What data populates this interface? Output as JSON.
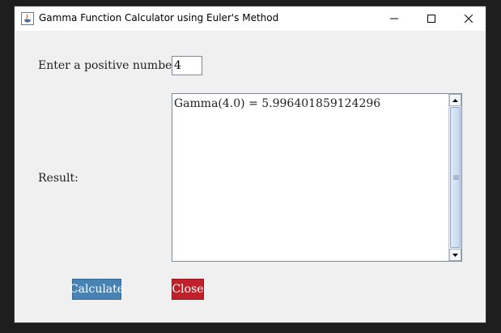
{
  "window": {
    "title": "Gamma Function Calculator using Euler's Method",
    "controls": {
      "minimize": "minimize-icon",
      "maximize": "maximize-icon",
      "close": "close-icon"
    }
  },
  "form": {
    "input_label": "Enter a positive number:",
    "input_value": "4",
    "result_label": "Result:",
    "result_text": "Gamma(4.0) = 5.996401859124296"
  },
  "buttons": {
    "calculate_label": "Calculate",
    "close_label": "Close"
  },
  "colors": {
    "calculate_bg": "#4682b4",
    "close_bg": "#c0202a",
    "window_bg": "#f0f0f0"
  }
}
